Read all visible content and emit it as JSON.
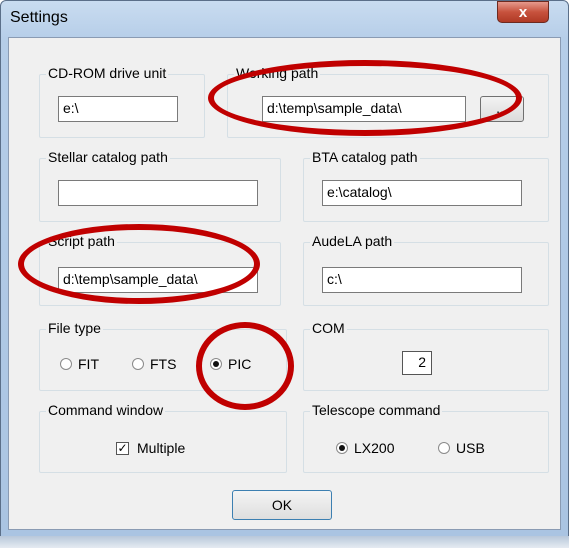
{
  "window": {
    "title": "Settings",
    "close_symbol": "x"
  },
  "groups": {
    "cdrom": {
      "label": "CD-ROM drive unit",
      "value": "e:\\"
    },
    "working": {
      "label": "Working path",
      "value": "d:\\temp\\sample_data\\",
      "browse_label": "..."
    },
    "stellar": {
      "label": "Stellar catalog path",
      "value": ""
    },
    "bta": {
      "label": "BTA catalog path",
      "value": "e:\\catalog\\"
    },
    "script": {
      "label": "Script path",
      "value": "d:\\temp\\sample_data\\"
    },
    "audela": {
      "label": "AudeLA path",
      "value": "c:\\"
    },
    "filetype": {
      "label": "File type",
      "options": [
        "FIT",
        "FTS",
        "PIC"
      ],
      "selected": "PIC"
    },
    "com": {
      "label": "COM",
      "value": "2"
    },
    "command": {
      "label": "Command window",
      "checkbox_label": "Multiple",
      "checked": true
    },
    "telescope": {
      "label": "Telescope command",
      "options": [
        "LX200",
        "USB"
      ],
      "selected": "LX200"
    }
  },
  "ok_label": "OK",
  "annotation_color": "#c00000"
}
